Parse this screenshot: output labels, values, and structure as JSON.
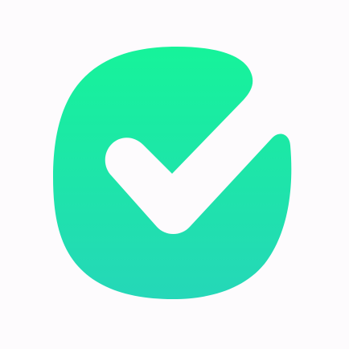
{
  "logo": {
    "icon": "checkmark-icon",
    "colors": {
      "background": "#fdfbfd",
      "gradient_top": "#16f39a",
      "gradient_bottom": "#25d7b8",
      "checkmark": "#ffffff"
    }
  }
}
